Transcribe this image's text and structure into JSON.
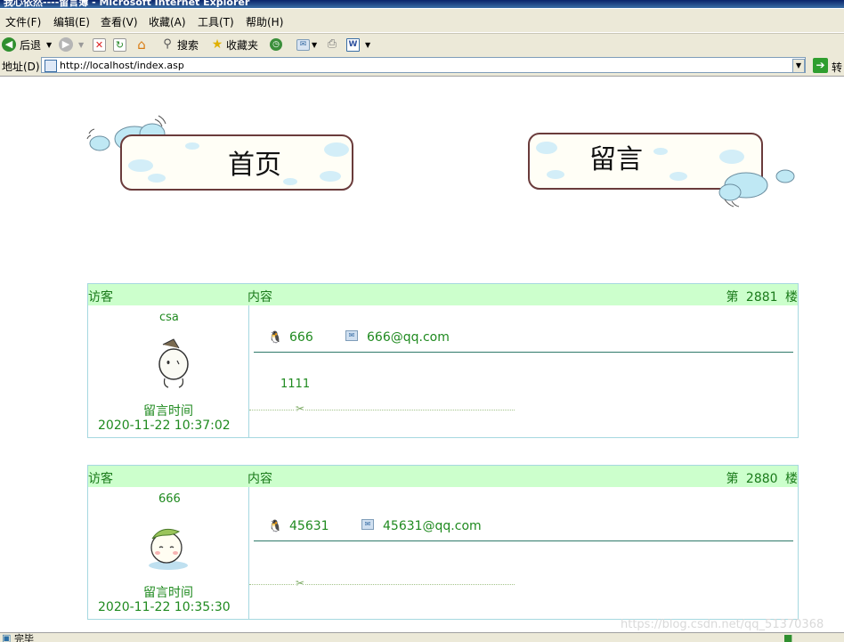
{
  "window": {
    "title": "我心依然----留言簿 - Microsoft Internet Explorer"
  },
  "menu": [
    "文件(F)",
    "编辑(E)",
    "查看(V)",
    "收藏(A)",
    "工具(T)",
    "帮助(H)"
  ],
  "toolbar": {
    "back": "后退",
    "search": "搜索",
    "favorites": "收藏夹"
  },
  "address": {
    "label": "地址(D)",
    "url": "http://localhost/index.asp",
    "go": "转"
  },
  "nav": {
    "home": "首页",
    "message": "留言"
  },
  "posts": [
    {
      "visitor_header": "访客",
      "content_header": "内容",
      "floor_prefix": "第",
      "floor": "2881",
      "floor_suffix": "楼",
      "name": "csa",
      "qq": "666",
      "email": "666@qq.com",
      "content": "1111",
      "time_label": "留言时间",
      "time": "2020-11-22 10:37:02"
    },
    {
      "visitor_header": "访客",
      "content_header": "内容",
      "floor_prefix": "第",
      "floor": "2880",
      "floor_suffix": "楼",
      "name": "666",
      "qq": "45631",
      "email": "45631@qq.com",
      "content": "",
      "time_label": "留言时间",
      "time": "2020-11-22 10:35:30"
    }
  ],
  "status": {
    "text": "完毕"
  },
  "watermark": "https://blog.csdn.net/qq_51370368",
  "colors": {
    "header_bg": "#ccffcc",
    "text_green": "#1f8a1f",
    "border": "#a6d8e0"
  }
}
